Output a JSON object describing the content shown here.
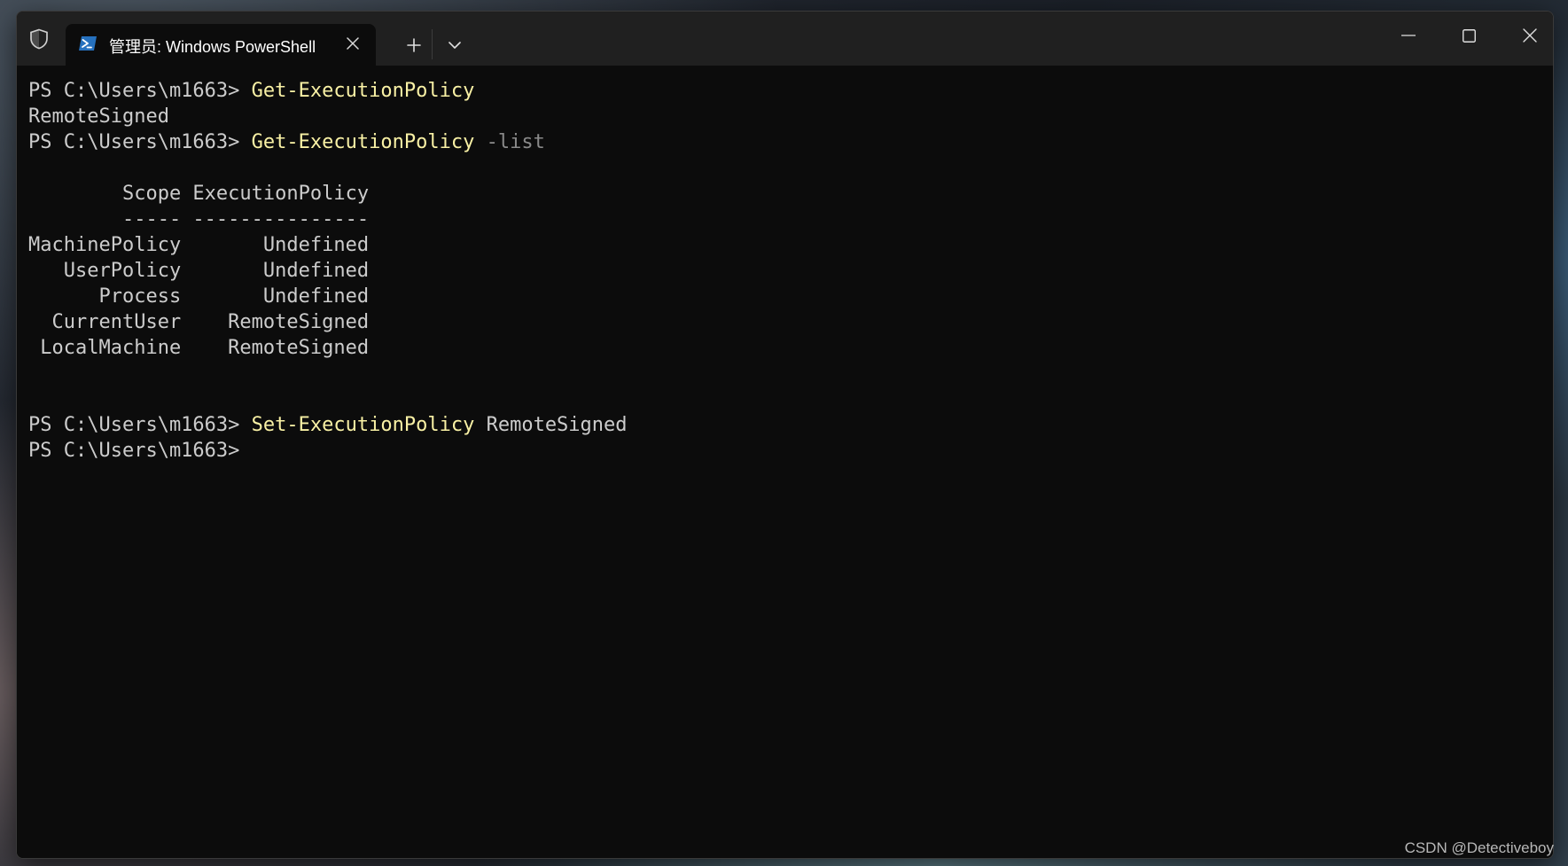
{
  "tab": {
    "title": "管理员: Windows PowerShell",
    "icon": "powershell-icon"
  },
  "titlebar": {
    "shield_icon": "shield-icon",
    "new_tab_icon": "plus-icon",
    "dropdown_icon": "chevron-down-icon",
    "close_tab_icon": "close-icon"
  },
  "window_controls": {
    "minimize_icon": "minimize-icon",
    "maximize_icon": "maximize-icon",
    "close_icon": "close-icon"
  },
  "terminal": {
    "line1": {
      "prompt": "PS C:\\Users\\m1663> ",
      "command": "Get-ExecutionPolicy"
    },
    "line2": {
      "text": "RemoteSigned"
    },
    "line3": {
      "prompt": "PS C:\\Users\\m1663> ",
      "command": "Get-ExecutionPolicy",
      "param": " -list"
    },
    "table": {
      "header": "        Scope ExecutionPolicy",
      "divider": "        ----- ---------------",
      "rows": [
        "MachinePolicy       Undefined",
        "   UserPolicy       Undefined",
        "      Process       Undefined",
        "  CurrentUser    RemoteSigned",
        " LocalMachine    RemoteSigned"
      ]
    },
    "line4": {
      "prompt": "PS C:\\Users\\m1663> ",
      "command": "Set-ExecutionPolicy",
      "arg": " RemoteSigned"
    },
    "line5": {
      "prompt": "PS C:\\Users\\m1663> "
    }
  },
  "colors": {
    "terminal_bg": "#0c0c0c",
    "text": "#cccccc",
    "command": "#f9f1a5",
    "parameter": "#8a8a8a"
  },
  "watermark": "CSDN @Detectiveboy"
}
